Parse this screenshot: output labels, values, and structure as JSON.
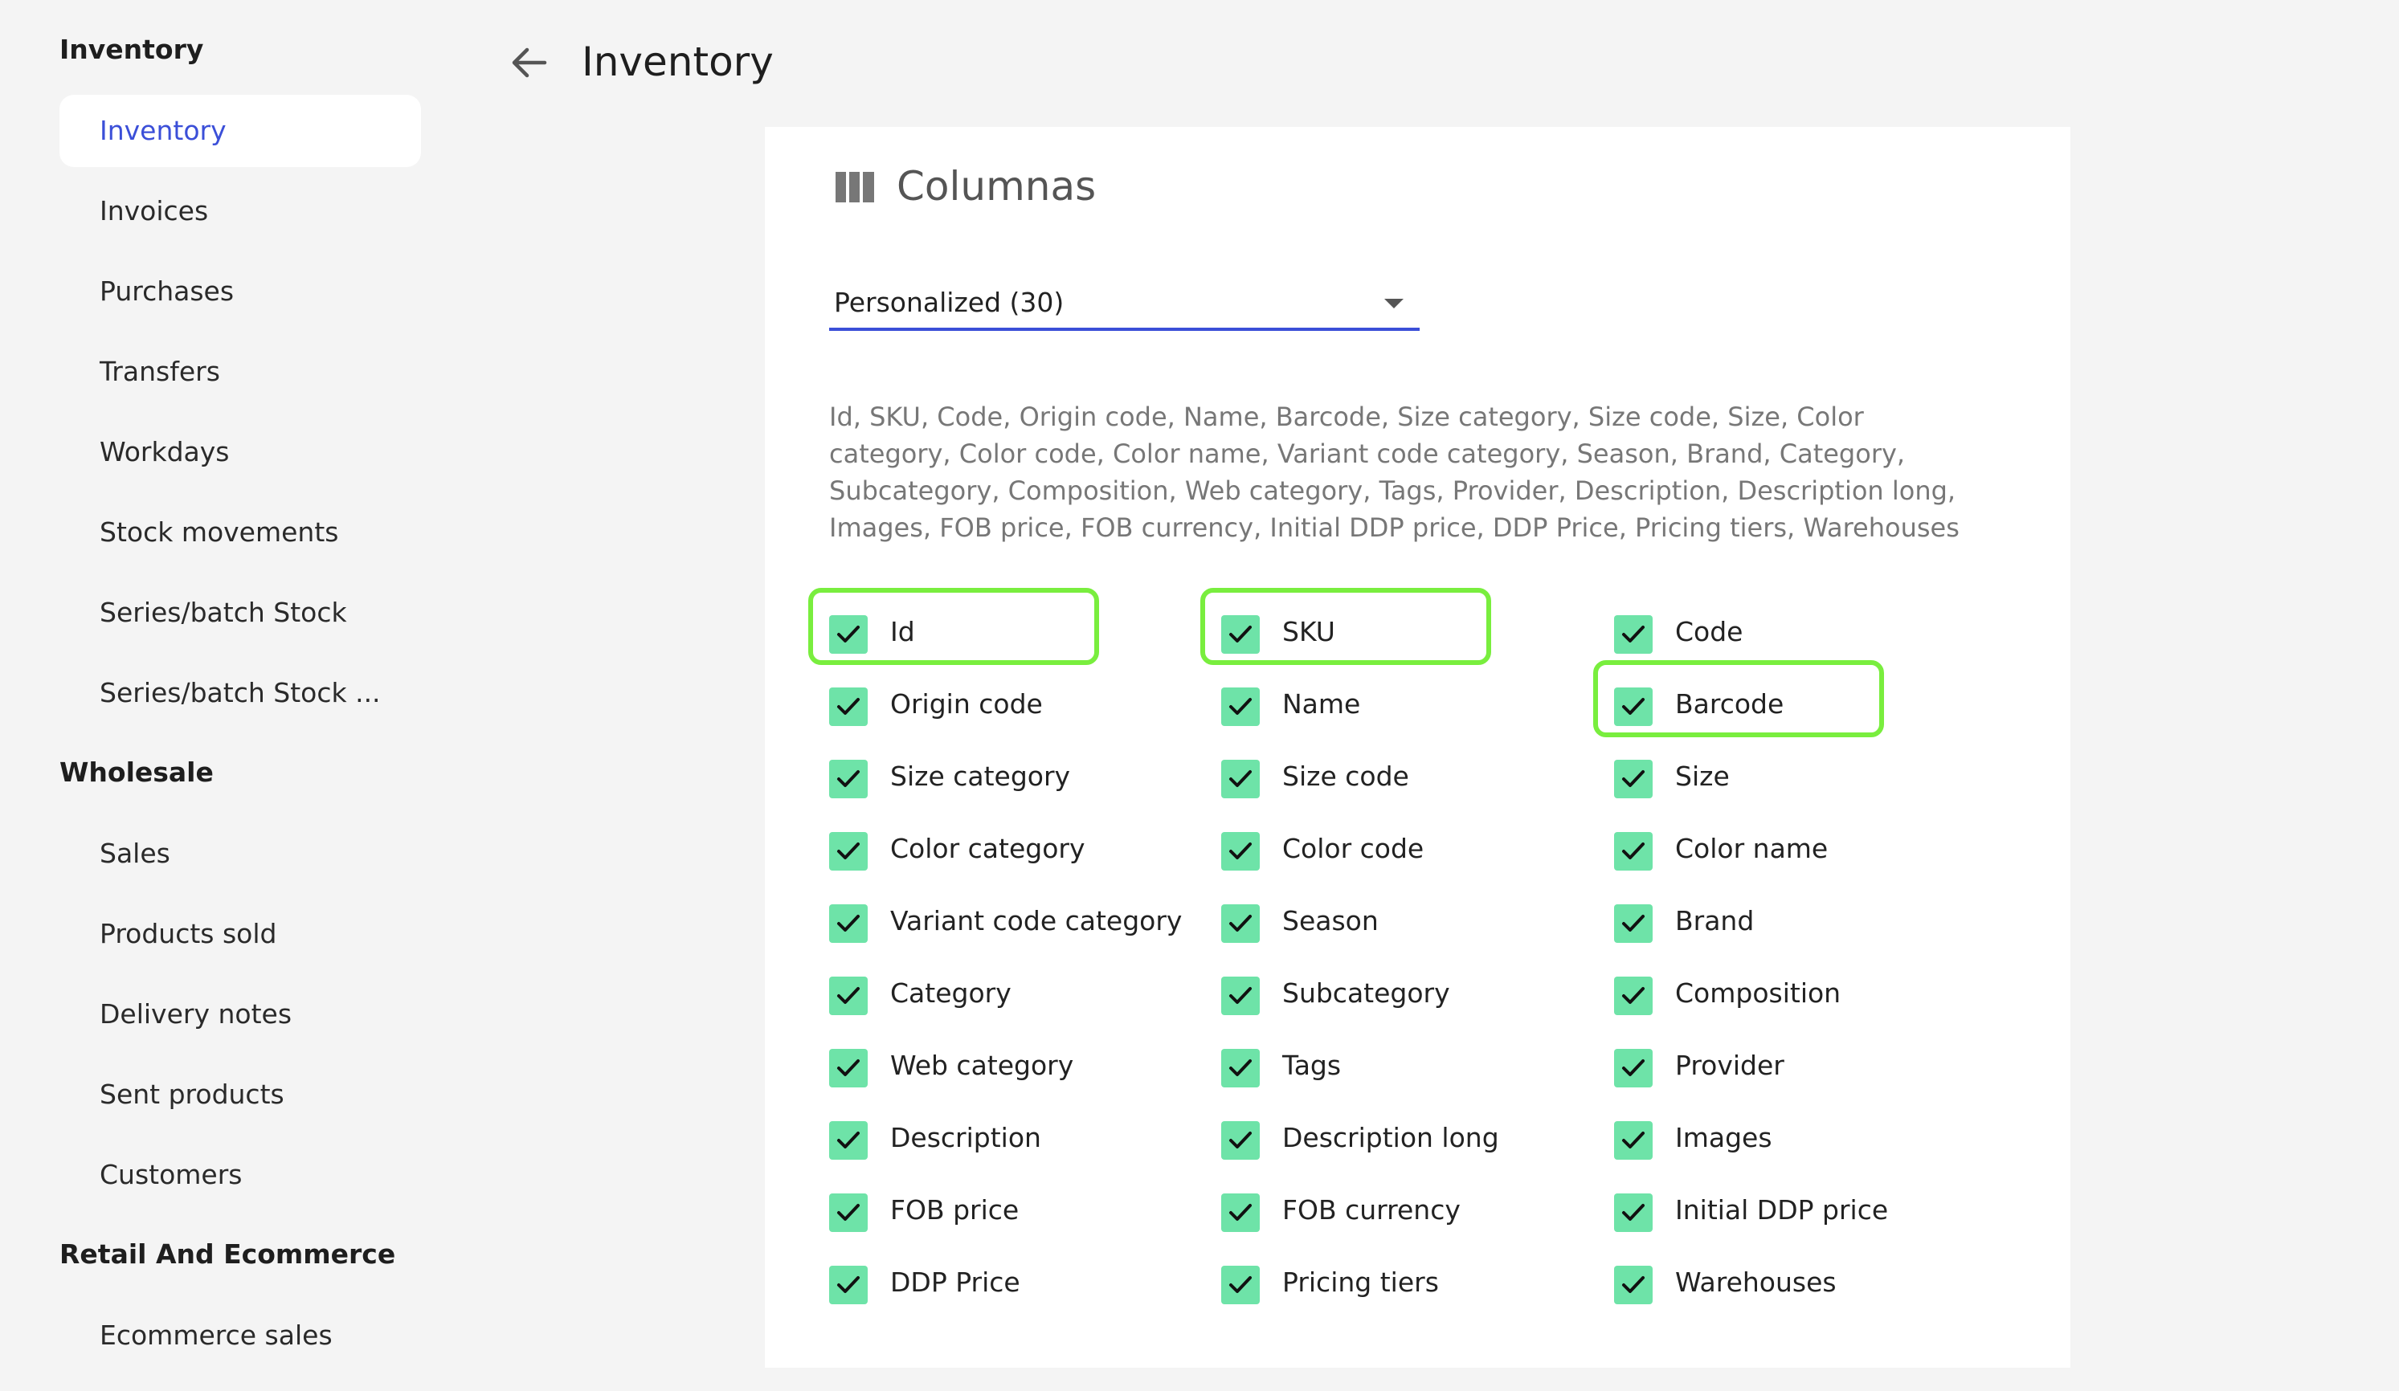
{
  "sidebar": {
    "sections": [
      {
        "title": "Inventory",
        "items": [
          "Inventory",
          "Invoices",
          "Purchases",
          "Transfers",
          "Workdays",
          "Stock movements",
          "Series/batch Stock",
          "Series/batch Stock ..."
        ]
      },
      {
        "title": "Wholesale",
        "items": [
          "Sales",
          "Products sold",
          "Delivery notes",
          "Sent products",
          "Customers"
        ]
      },
      {
        "title": "Retail And Ecommerce",
        "items": [
          "Ecommerce sales"
        ]
      }
    ],
    "active_item": "Inventory"
  },
  "header": {
    "back_icon": "arrow-left-icon",
    "title": "Inventory"
  },
  "card": {
    "icon": "view-column-icon",
    "title": "Columnas",
    "preset_select": {
      "value": "Personalized (30)"
    },
    "summary": "Id, SKU, Code, Origin code, Name, Barcode, Size category, Size code, Size, Color category, Color code, Color name, Variant code category, Season, Brand, Category, Subcategory, Composition, Web category, Tags, Provider, Description, Description long, Images, FOB price, FOB currency, Initial DDP price, DDP Price, Pricing tiers, Warehouses",
    "columns": [
      {
        "label": "Id",
        "checked": true,
        "highlighted": true
      },
      {
        "label": "SKU",
        "checked": true,
        "highlighted": true
      },
      {
        "label": "Code",
        "checked": true,
        "highlighted": false
      },
      {
        "label": "Origin code",
        "checked": true,
        "highlighted": false
      },
      {
        "label": "Name",
        "checked": true,
        "highlighted": false
      },
      {
        "label": "Barcode",
        "checked": true,
        "highlighted": true
      },
      {
        "label": "Size category",
        "checked": true,
        "highlighted": false
      },
      {
        "label": "Size code",
        "checked": true,
        "highlighted": false
      },
      {
        "label": "Size",
        "checked": true,
        "highlighted": false
      },
      {
        "label": "Color category",
        "checked": true,
        "highlighted": false
      },
      {
        "label": "Color code",
        "checked": true,
        "highlighted": false
      },
      {
        "label": "Color name",
        "checked": true,
        "highlighted": false
      },
      {
        "label": "Variant code category",
        "checked": true,
        "highlighted": false
      },
      {
        "label": "Season",
        "checked": true,
        "highlighted": false
      },
      {
        "label": "Brand",
        "checked": true,
        "highlighted": false
      },
      {
        "label": "Category",
        "checked": true,
        "highlighted": false
      },
      {
        "label": "Subcategory",
        "checked": true,
        "highlighted": false
      },
      {
        "label": "Composition",
        "checked": true,
        "highlighted": false
      },
      {
        "label": "Web category",
        "checked": true,
        "highlighted": false
      },
      {
        "label": "Tags",
        "checked": true,
        "highlighted": false
      },
      {
        "label": "Provider",
        "checked": true,
        "highlighted": false
      },
      {
        "label": "Description",
        "checked": true,
        "highlighted": false
      },
      {
        "label": "Description long",
        "checked": true,
        "highlighted": false
      },
      {
        "label": "Images",
        "checked": true,
        "highlighted": false
      },
      {
        "label": "FOB price",
        "checked": true,
        "highlighted": false
      },
      {
        "label": "FOB currency",
        "checked": true,
        "highlighted": false
      },
      {
        "label": "Initial DDP price",
        "checked": true,
        "highlighted": false
      },
      {
        "label": "DDP Price",
        "checked": true,
        "highlighted": false
      },
      {
        "label": "Pricing tiers",
        "checked": true,
        "highlighted": false
      },
      {
        "label": "Warehouses",
        "checked": true,
        "highlighted": false
      }
    ]
  },
  "colors": {
    "accent": "#3b4fd8",
    "checkbox": "#6ee3a8",
    "highlight": "#79ee3e",
    "background": "#f4f4f4"
  }
}
